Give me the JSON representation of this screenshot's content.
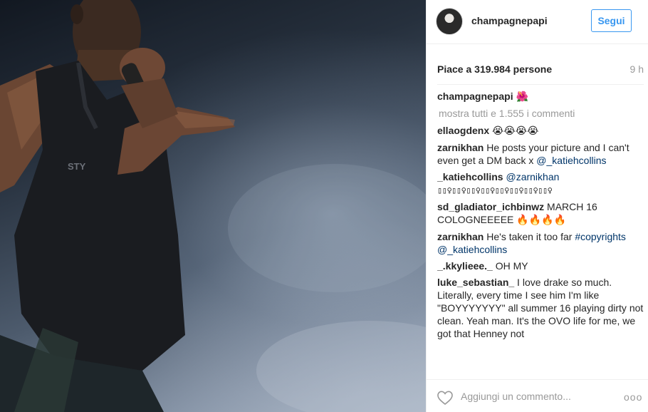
{
  "post": {
    "username": "champagnepapi",
    "follow_label": "Segui",
    "likes": "Piace a 319.984 persone",
    "time": "9 h",
    "caption_user": "champagnepapi",
    "caption_emoji": "🌺",
    "view_all": "mostra tutti e 1.555 i commenti",
    "add_comment_placeholder": "Aggiungi un commento...",
    "more_label": "ooo"
  },
  "comments": [
    {
      "user": "ellaogdenx",
      "text": " ",
      "emoji": "😭😭😭😭"
    },
    {
      "user": "zarnikhan",
      "text": " He posts your picture and I can't even get a DM back x ",
      "link": "@_katiehcollins"
    },
    {
      "user": "_katiehcollins",
      "link": "@zarnikhan",
      "text": " ",
      "boxes": "▯▯♀▯▯♀▯▯♀▯▯♀▯▯♀▯▯♀▯▯♀▯▯♀"
    },
    {
      "user": "sd_gladiator_ichbinwz",
      "text": " MARCH 16 COLOGNEEEEE ",
      "emoji": "🔥🔥🔥🔥"
    },
    {
      "user": "zarnikhan",
      "text": " He's taken it too far ",
      "link": "#copyrights @_katiehcollins"
    },
    {
      "user": "_.kkylieee._",
      "text": " OH MY"
    },
    {
      "user": "luke_sebastian_",
      "text": " I love drake so much. Literally, every time I see him I'm like \"BOYYYYYYY\" all summer 16 playing dirty not clean. Yeah man. It's the OVO life for me, we got that Henney not"
    }
  ],
  "photo": {
    "shirt_text": "STY  "
  }
}
